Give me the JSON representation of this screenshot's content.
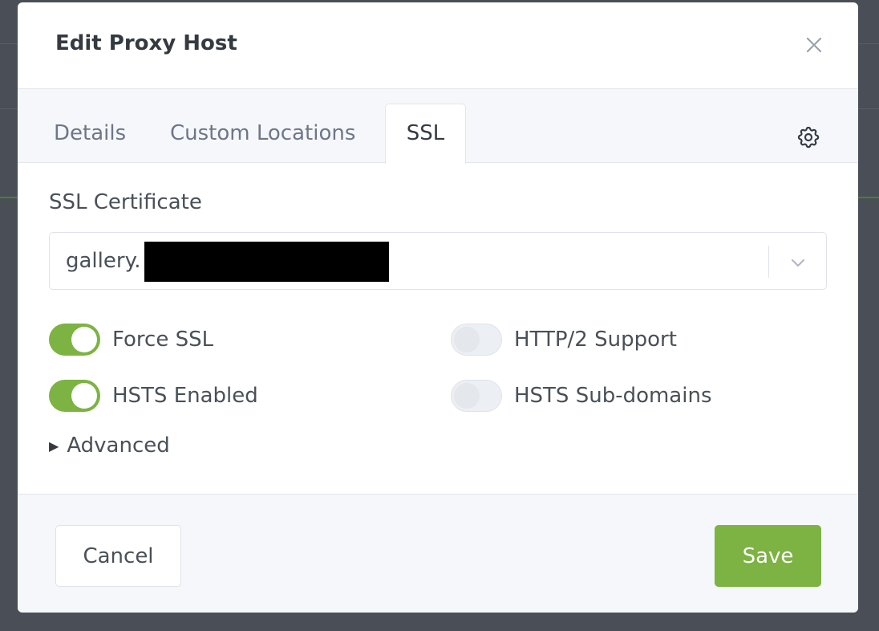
{
  "modal": {
    "title": "Edit Proxy Host"
  },
  "tabs": [
    {
      "label": "Details"
    },
    {
      "label": "Custom Locations"
    },
    {
      "label": "SSL"
    }
  ],
  "ssl": {
    "certificate_label": "SSL Certificate",
    "certificate_value": "gallery.",
    "toggles": {
      "force_ssl": {
        "label": "Force SSL",
        "checked": true
      },
      "http2": {
        "label": "HTTP/2 Support",
        "checked": false
      },
      "hsts_enabled": {
        "label": "HSTS Enabled",
        "checked": true
      },
      "hsts_subdomains": {
        "label": "HSTS Sub-domains",
        "checked": false
      }
    },
    "advanced_label": "Advanced"
  },
  "footer": {
    "cancel_label": "Cancel",
    "save_label": "Save"
  },
  "colors": {
    "accent": "#7cb342",
    "overlay": "#4a4f57"
  },
  "icons": {
    "close": "close-icon",
    "settings": "gear-icon",
    "dropdown": "chevron-down-icon",
    "disclosure": "triangle-right-icon"
  }
}
